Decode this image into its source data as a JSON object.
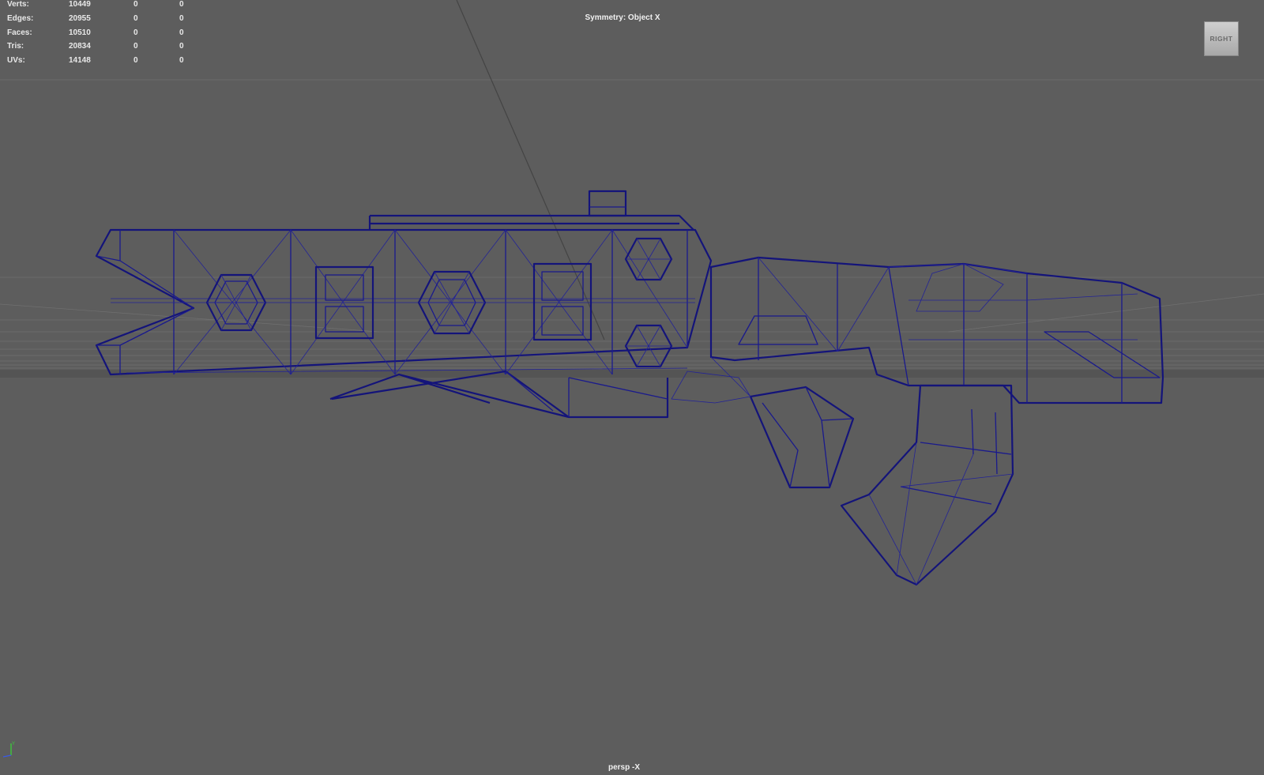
{
  "hud": {
    "rows": [
      {
        "label": "Verts:",
        "values": [
          "10449",
          "0",
          "0"
        ]
      },
      {
        "label": "Edges:",
        "values": [
          "20955",
          "0",
          "0"
        ]
      },
      {
        "label": "Faces:",
        "values": [
          "10510",
          "0",
          "0"
        ]
      },
      {
        "label": "Tris:",
        "values": [
          "20834",
          "0",
          "0"
        ]
      },
      {
        "label": "UVs:",
        "values": [
          "14148",
          "0",
          "0"
        ]
      }
    ]
  },
  "symmetry_label": "Symmetry: Object X",
  "view_cube_label": "RIGHT",
  "camera_label": "persp -X",
  "colors": {
    "viewport_bg": "#5d5d5d",
    "wireframe": "#1a1a8c",
    "hud_text": "#e8e8e8"
  }
}
